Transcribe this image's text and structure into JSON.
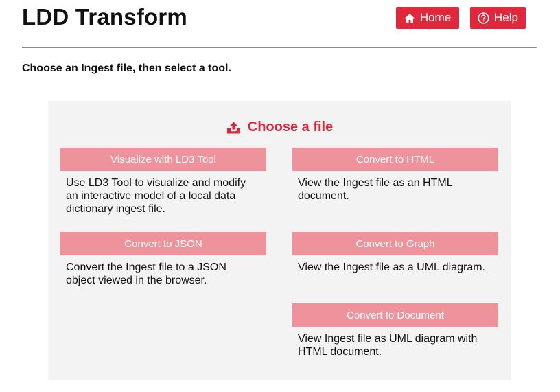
{
  "header": {
    "title": "LDD Transform",
    "home_label": "Home",
    "help_label": "Help"
  },
  "instruction": "Choose an Ingest file, then select a tool.",
  "panel": {
    "choose_file_label": "Choose a file",
    "tools": [
      {
        "label": "Visualize with LD3 Tool",
        "description": "Use LD3 Tool to visualize and modify an interactive model of a local data dictionary ingest file."
      },
      {
        "label": "Convert to HTML",
        "description": "View the Ingest file as an HTML document."
      },
      {
        "label": "Convert to JSON",
        "description": "Convert the Ingest file to a JSON object viewed in the browser."
      },
      {
        "label": "Convert to Graph",
        "description": "View the Ingest file as a UML diagram."
      },
      {
        "label": "Convert to Document",
        "description": "View Ingest file as UML diagram with HTML document."
      }
    ]
  },
  "colors": {
    "accent": "#e0283c",
    "tool_button": "#ee939b",
    "panel_bg": "#f3f3f3"
  },
  "icons": [
    "home-icon",
    "help-icon",
    "upload-icon"
  ]
}
